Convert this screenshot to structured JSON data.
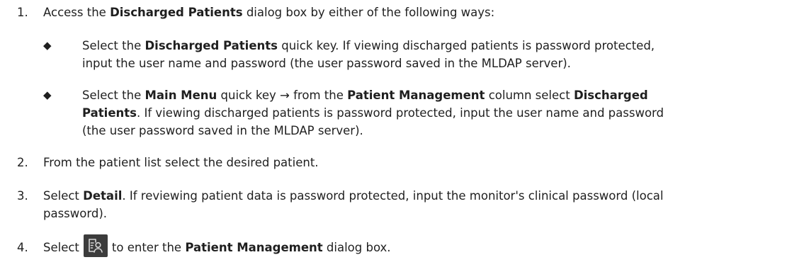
{
  "steps": [
    {
      "number": "1.",
      "parts": {
        "a": "Access the ",
        "b": "Discharged Patients",
        "c": " dialog box by either of the following ways:"
      },
      "bullets": [
        {
          "mark": "◆",
          "line1a": "Select the ",
          "line1b": "Discharged Patients",
          "line1c": " quick key. If viewing discharged patients is password protected,",
          "line2": "input the user name and password (the user password saved in the MLDAP server)."
        },
        {
          "mark": "◆",
          "line1a": "Select the ",
          "line1b": "Main Menu",
          "line1c": " quick key → from the ",
          "line1d": "Patient Management",
          "line1e": " column select ",
          "line1f": "Discharged",
          "line2a": "Patients",
          "line2b": ". If viewing discharged patients is password protected, input the user name and password",
          "line3": "(the user password saved in the MLDAP server)."
        }
      ]
    },
    {
      "number": "2.",
      "text": "From the patient list select the desired patient."
    },
    {
      "number": "3.",
      "parts": {
        "a": "Select ",
        "b": "Detail",
        "c": ". If reviewing patient data is password protected, input the monitor's clinical password (local",
        "d": "password)."
      }
    },
    {
      "number": "4.",
      "parts": {
        "a": "Select",
        "icon": "patient-management-icon",
        "b": "to enter the ",
        "c": "Patient Management",
        "d": " dialog box."
      }
    }
  ],
  "colors": {
    "text": "#1f1f1f",
    "icon_background": "#3c3c3c",
    "icon_stroke": "#d6d6d6"
  }
}
